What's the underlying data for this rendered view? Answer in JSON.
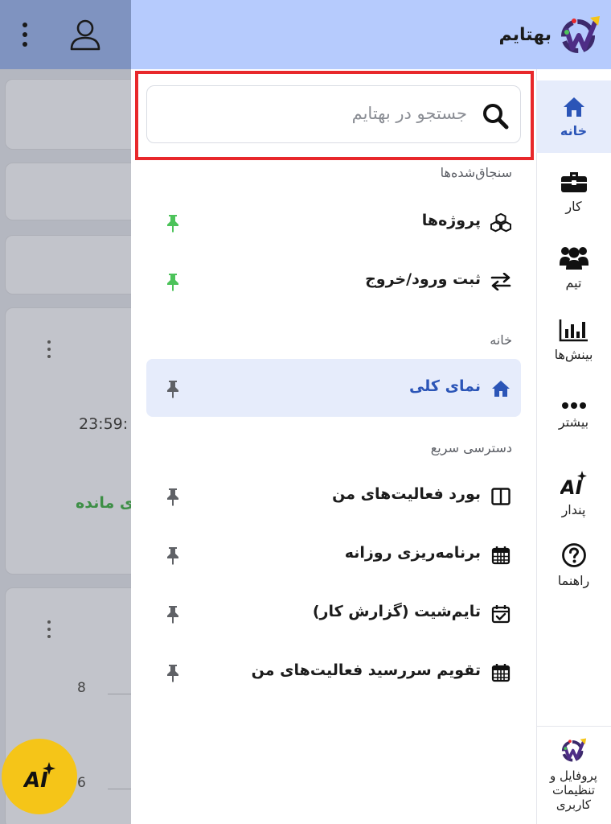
{
  "app": {
    "brand_name": "بهتایم"
  },
  "background": {
    "time_fragment": "23:59:",
    "remaining_fragment": "ی مانده",
    "axis_values": [
      "8",
      "6"
    ]
  },
  "search": {
    "placeholder": "جستجو در بهتایم"
  },
  "sections": {
    "pinned": {
      "title": "سنجاق‌شده‌ها",
      "items": [
        {
          "label": "پروژه‌ها",
          "icon": "cubes-icon",
          "pinned": true
        },
        {
          "label": "ثبت ورود/خروج",
          "icon": "exchange-arrows-icon",
          "pinned": true
        }
      ]
    },
    "home": {
      "title": "خانه",
      "items": [
        {
          "label": "نمای کلی",
          "icon": "home-icon",
          "pinned": false,
          "active": true
        }
      ]
    },
    "quick_access": {
      "title": "دسترسی سریع",
      "items": [
        {
          "label": "بورد فعالیت‌های من",
          "icon": "board-columns-icon",
          "pinned": false
        },
        {
          "label": "برنامه‌ریزی روزانه",
          "icon": "calendar-grid-icon",
          "pinned": false
        },
        {
          "label": "تایم‌شیت (گزارش کار)",
          "icon": "calendar-check-icon",
          "pinned": false
        },
        {
          "label": "تقویم سررسید فعالیت‌های من",
          "icon": "calendar-grid-icon",
          "pinned": false
        }
      ]
    }
  },
  "rail": {
    "items": [
      {
        "label": "خانه",
        "icon": "home-icon",
        "active": true
      },
      {
        "label": "کار",
        "icon": "briefcase-icon"
      },
      {
        "label": "تیم",
        "icon": "users-icon"
      },
      {
        "label": "بینش‌ها",
        "icon": "bar-chart-icon"
      },
      {
        "label": "بیشتر",
        "icon": "more-dots-icon"
      },
      {
        "label": "پندار",
        "icon": "ai-sparkle-icon"
      },
      {
        "label": "راهنما",
        "icon": "help-icon"
      }
    ],
    "profile_label": "پروفایل و تنظیمات کاربری"
  },
  "colors": {
    "accent": "#2b55b7",
    "header_bg": "#b6cbfd",
    "active_bg": "#e6ecfb",
    "pinned_green": "#4cc35a",
    "highlight_red": "#e8282b",
    "fab_yellow": "#f5c518"
  }
}
